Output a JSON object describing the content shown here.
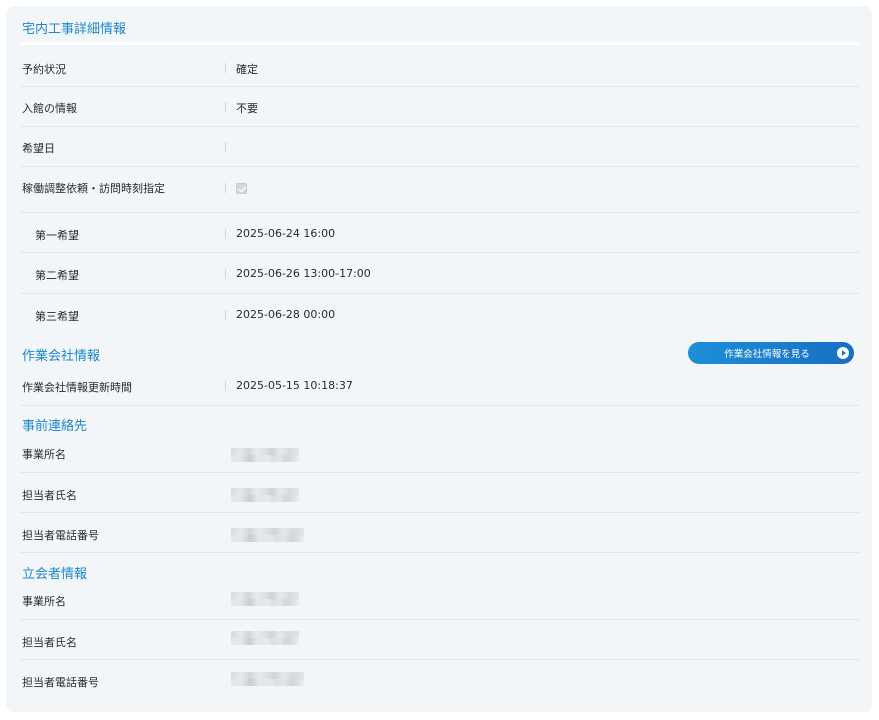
{
  "colors": {
    "card_bg": "#f3f6f9",
    "section_title": "#1e88c8",
    "button_gradient_start": "#1d8fd8",
    "button_gradient_end": "#1a6ec2",
    "divider": "#e1e6eb"
  },
  "home_work": {
    "title": "宅内工事詳細情報",
    "reservation_status": {
      "label": "予約状況",
      "value": "確定"
    },
    "building_entry": {
      "label": "入館の情報",
      "value": "不要"
    },
    "desired_date": {
      "label": "希望日",
      "value": ""
    },
    "visit_time_request": {
      "label": "稼働調整依頼・訪問時刻指定",
      "checked": true,
      "disabled": true
    },
    "first_choice": {
      "label": "第一希望",
      "value": "2025-06-24  16:00"
    },
    "second_choice": {
      "label": "第二希望",
      "value": "2025-06-26  13:00-17:00"
    },
    "third_choice": {
      "label": "第三希望",
      "value": "2025-06-28  00:00"
    }
  },
  "work_company": {
    "title": "作業会社情報",
    "view_button_label": "作業会社情報を見る",
    "view_button_icon": "play-circle-icon",
    "updated": {
      "label": "作業会社情報更新時間",
      "value": "2025-05-15 10:18:37"
    }
  },
  "prior_contact": {
    "title": "事前連絡先",
    "office_name": {
      "label": "事業所名"
    },
    "person_name": {
      "label": "担当者氏名"
    },
    "person_phone": {
      "label": "担当者電話番号"
    }
  },
  "attendee": {
    "title": "立会者情報",
    "office_name": {
      "label": "事業所名"
    },
    "person_name": {
      "label": "担当者氏名"
    },
    "person_phone": {
      "label": "担当者電話番号"
    }
  }
}
